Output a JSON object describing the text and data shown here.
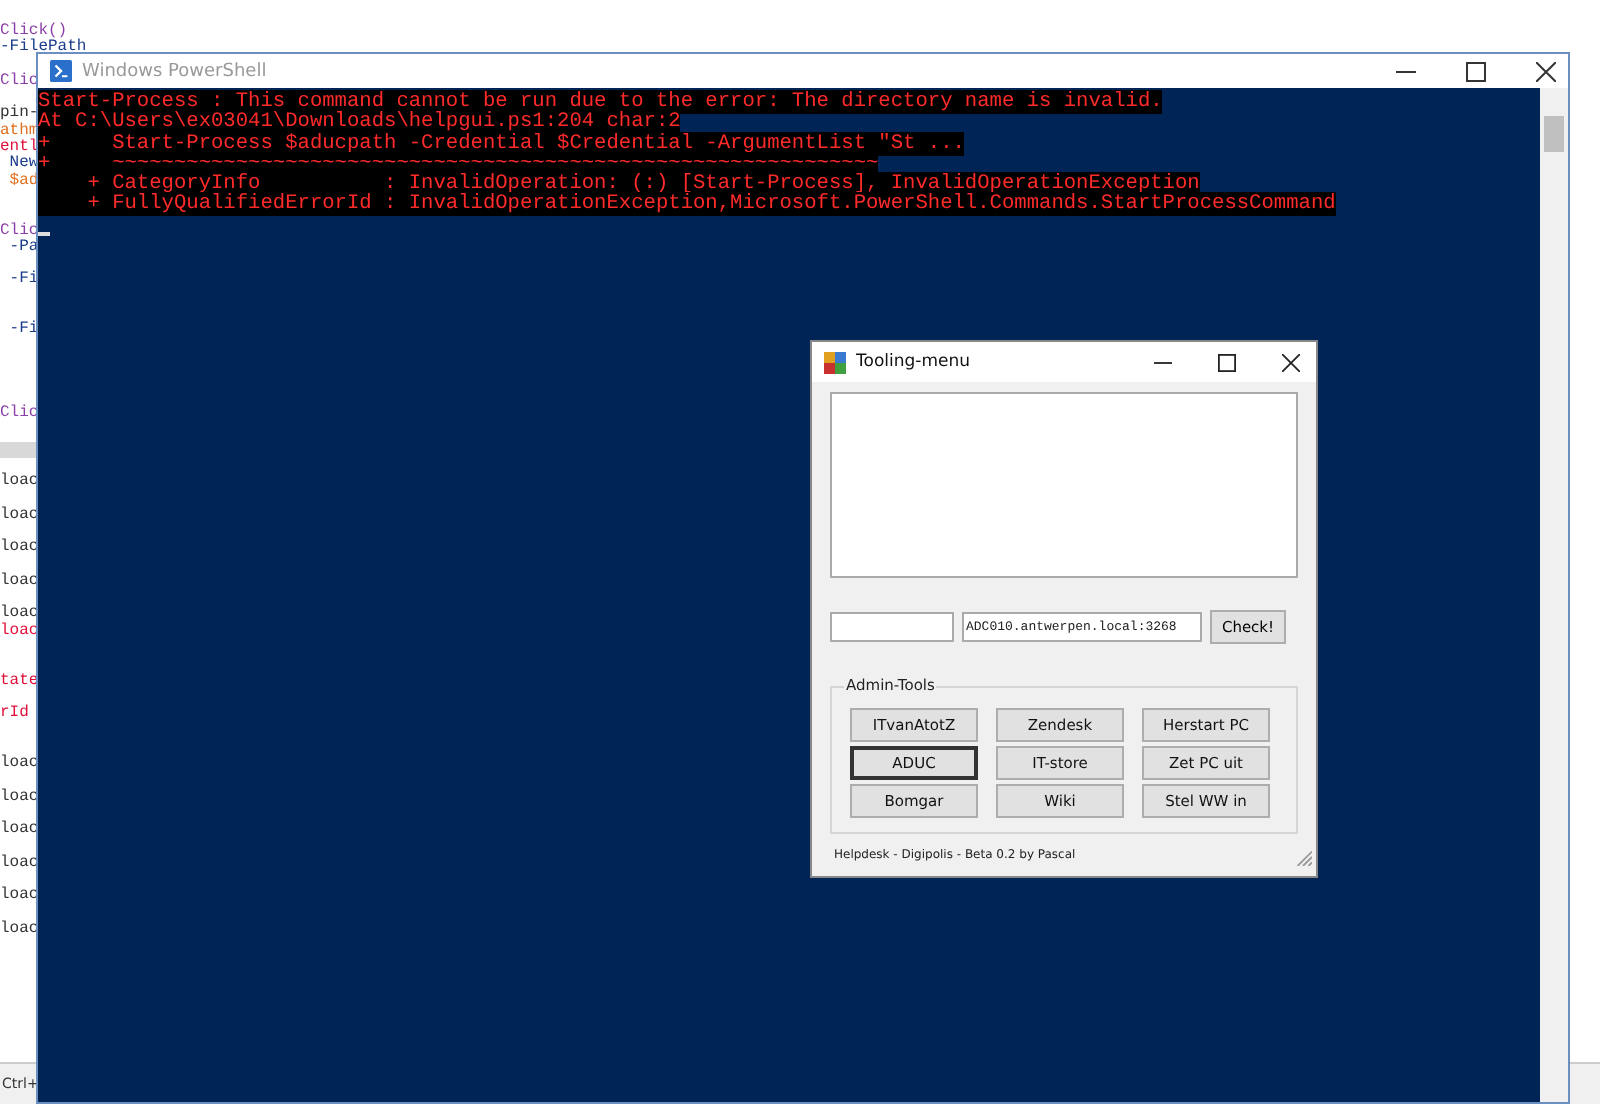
{
  "editor": {
    "script_lines": [
      {
        "kind": "keyword",
        "text": "Click()"
      },
      {
        "kind": "param",
        "text": "-FilePath"
      },
      {
        "kind": "blank"
      },
      {
        "kind": "keyword",
        "text": "Clic"
      },
      {
        "kind": "blank"
      },
      {
        "kind": "code",
        "text": "pin-"
      },
      {
        "kind": "variable",
        "text": "athm"
      },
      {
        "kind": "error",
        "text": "entl"
      },
      {
        "kind": "param",
        "text": " New"
      },
      {
        "kind": "variable",
        "text": " $ad"
      },
      {
        "kind": "blank"
      },
      {
        "kind": "blank"
      },
      {
        "kind": "keyword",
        "text": "Clic"
      },
      {
        "kind": "param",
        "text": " -Pa"
      },
      {
        "kind": "blank"
      },
      {
        "kind": "param",
        "text": " -Fi"
      },
      {
        "kind": "blank"
      },
      {
        "kind": "blank"
      },
      {
        "kind": "param",
        "text": " -Fi"
      },
      {
        "kind": "blank"
      },
      {
        "kind": "blank"
      },
      {
        "kind": "blank"
      },
      {
        "kind": "blank"
      },
      {
        "kind": "keyword",
        "text": "Clic"
      }
    ],
    "console_lines": [
      {
        "kind": "code",
        "text": "loac"
      },
      {
        "kind": "blank"
      },
      {
        "kind": "code",
        "text": "loac"
      },
      {
        "kind": "blank"
      },
      {
        "kind": "code",
        "text": "loac"
      },
      {
        "kind": "blank"
      },
      {
        "kind": "code",
        "text": "loac"
      },
      {
        "kind": "blank"
      },
      {
        "kind": "code",
        "text": "loac"
      },
      {
        "kind": "error",
        "text": "loac"
      },
      {
        "kind": "blank"
      },
      {
        "kind": "blank"
      },
      {
        "kind": "error",
        "text": "tate"
      },
      {
        "kind": "blank"
      },
      {
        "kind": "error",
        "text": "rId"
      },
      {
        "kind": "blank"
      },
      {
        "kind": "blank"
      },
      {
        "kind": "code",
        "text": "loac"
      },
      {
        "kind": "blank"
      },
      {
        "kind": "code",
        "text": "loac"
      },
      {
        "kind": "blank"
      },
      {
        "kind": "code",
        "text": "loac"
      },
      {
        "kind": "blank"
      },
      {
        "kind": "code",
        "text": "loac"
      },
      {
        "kind": "blank"
      },
      {
        "kind": "code",
        "text": "loac"
      },
      {
        "kind": "blank"
      },
      {
        "kind": "code",
        "text": "loac"
      }
    ],
    "status_text": "Ctrl+"
  },
  "powershell": {
    "title": "Windows PowerShell",
    "output_lines": [
      {
        "kind": "error",
        "text": "Start-Process : This command cannot be run due to the error: The directory name is invalid."
      },
      {
        "kind": "error",
        "text": "At C:\\Users\\ex03041\\Downloads\\helpgui.ps1:204 char:2"
      },
      {
        "kind": "error",
        "text": "+     Start-Process $aducpath -Credential $Credential -ArgumentList \"St ..."
      },
      {
        "kind": "error",
        "text": "+     ~~~~~~~~~~~~~~~~~~~~~~~~~~~~~~~~~~~~~~~~~~~~~~~~~~~~~~~~~~~~~~"
      },
      {
        "kind": "error",
        "text": "    + CategoryInfo          : InvalidOperation: (:) [Start-Process], InvalidOperationException"
      },
      {
        "kind": "error",
        "text": "    + FullyQualifiedErrorId : InvalidOperationException,Microsoft.PowerShell.Commands.StartProcessCommand"
      }
    ]
  },
  "tooling_menu": {
    "title": "Tooling-menu",
    "server_field": {
      "value": "ADC010.antwerpen.local:3268"
    },
    "check_button": "Check!",
    "group": {
      "title": "Admin-Tools",
      "buttons": [
        {
          "label": "ITvanAtotZ",
          "focused": false
        },
        {
          "label": "Zendesk",
          "focused": false
        },
        {
          "label": "Herstart PC",
          "focused": false
        },
        {
          "label": "ADUC",
          "focused": true
        },
        {
          "label": "IT-store",
          "focused": false
        },
        {
          "label": "Zet PC uit",
          "focused": false
        },
        {
          "label": "Bomgar",
          "focused": false
        },
        {
          "label": "Wiki",
          "focused": false
        },
        {
          "label": "Stel WW in",
          "focused": false
        }
      ]
    },
    "footer": "Helpdesk - Digipolis - Beta 0.2 by Pascal"
  }
}
